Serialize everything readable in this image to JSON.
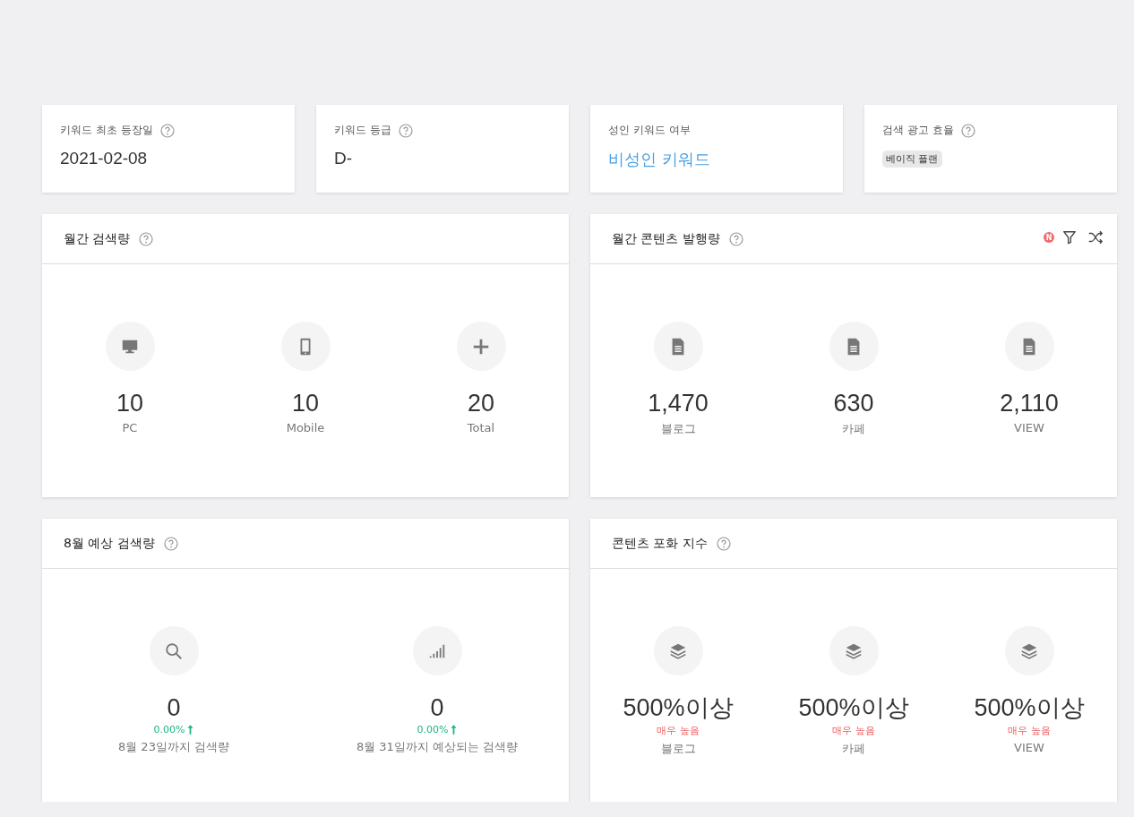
{
  "summary_cards": [
    {
      "label": "키워드 최초 등장일",
      "help": true,
      "kind": "text",
      "value": "2021-02-08"
    },
    {
      "label": "키워드 등급",
      "help": true,
      "kind": "text",
      "value": "D-"
    },
    {
      "label": "성인 키워드 여부",
      "help": false,
      "kind": "link",
      "value": "비성인 키워드"
    },
    {
      "label": "검색 광고 효율",
      "help": true,
      "kind": "tag",
      "value": "베이직 플랜"
    }
  ],
  "panels": [
    {
      "title": "월간 검색량",
      "help": true,
      "stats": [
        {
          "kind": "monitor",
          "value": "10",
          "label": "PC"
        },
        {
          "kind": "phone",
          "value": "10",
          "label": "Mobile"
        },
        {
          "kind": "plus",
          "value": "20",
          "label": "Total"
        }
      ]
    },
    {
      "title": "월간 콘텐츠 발행량",
      "help": true,
      "badge": "N",
      "stats": [
        {
          "kind": "document",
          "value": "1,470",
          "label": "블로그"
        },
        {
          "kind": "document",
          "value": "630",
          "label": "카페"
        },
        {
          "kind": "document",
          "value": "2,110",
          "label": "VIEW"
        }
      ]
    },
    {
      "title": "8월 예상 검색량",
      "help": true,
      "stats": [
        {
          "kind": "search",
          "value": "0",
          "change": "0.00%",
          "label": "8월 23일까지 검색량"
        },
        {
          "kind": "signal",
          "value": "0",
          "change": "0.00%",
          "label": "8월 31일까지 예상되는 검색량"
        }
      ]
    },
    {
      "title": "콘텐츠 포화 지수",
      "help": true,
      "stats": [
        {
          "kind": "layers",
          "value": "500%이상",
          "rating": "매우 높음",
          "label": "블로그"
        },
        {
          "kind": "layers",
          "value": "500%이상",
          "rating": "매우 높음",
          "label": "카페"
        },
        {
          "kind": "layers",
          "value": "500%이상",
          "rating": "매우 높음",
          "label": "VIEW"
        }
      ]
    }
  ]
}
